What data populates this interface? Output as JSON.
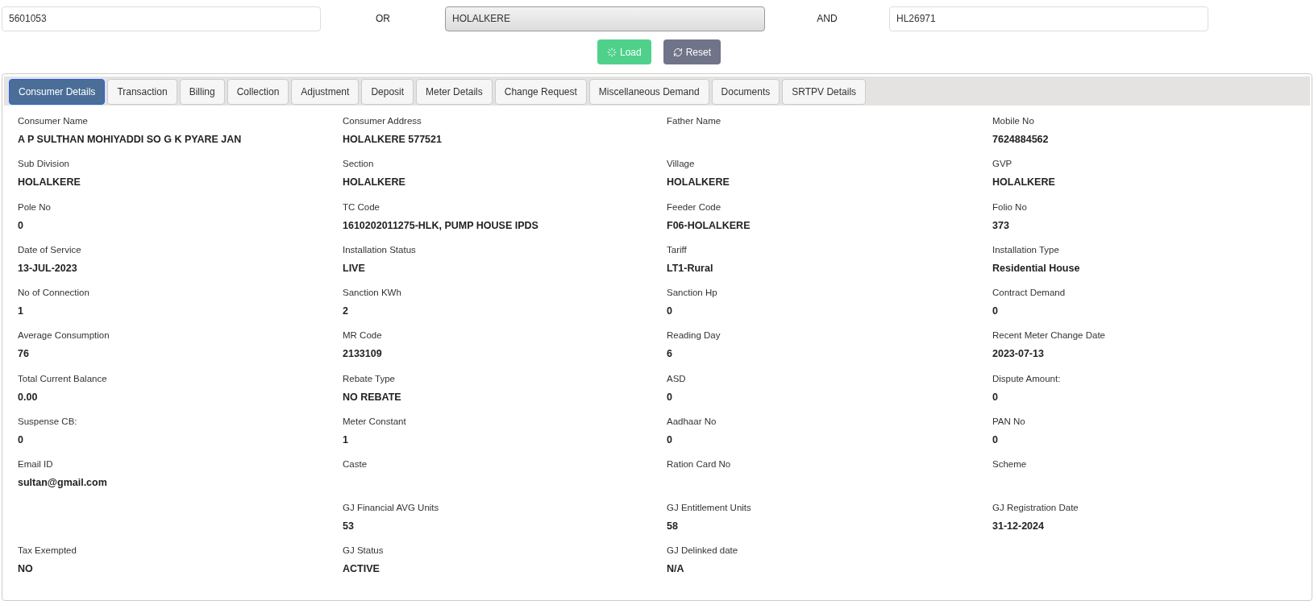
{
  "search": {
    "fields": [
      {
        "value": "5601053"
      },
      {
        "value": "HOLALKERE"
      },
      {
        "value": "HL26971"
      }
    ],
    "connectors": [
      "OR",
      "AND"
    ]
  },
  "buttons": [
    {
      "kind": "load",
      "label": "Load"
    },
    {
      "kind": "reset",
      "label": "Reset"
    }
  ],
  "tabs": [
    {
      "label": "Consumer Details",
      "selected": true
    },
    {
      "label": "Transaction",
      "selected": false
    },
    {
      "label": "Billing",
      "selected": false
    },
    {
      "label": "Collection",
      "selected": false
    },
    {
      "label": "Adjustment",
      "selected": false
    },
    {
      "label": "Deposit",
      "selected": false
    },
    {
      "label": "Meter Details",
      "selected": false
    },
    {
      "label": "Change Request",
      "selected": false
    },
    {
      "label": "Miscellaneous Demand",
      "selected": false
    },
    {
      "label": "Documents",
      "selected": false
    },
    {
      "label": "SRTPV Details",
      "selected": false
    }
  ],
  "details": [
    [
      {
        "kind": "field",
        "label": "Consumer Name",
        "value": "A P SULTHAN MOHIYADDI SO G K PYARE JAN"
      },
      {
        "kind": "field",
        "label": "Consumer Address",
        "value": "HOLALKERE 577521"
      },
      {
        "kind": "field",
        "label": "Father Name"
      },
      {
        "kind": "field",
        "label": "Mobile No",
        "value": "7624884562"
      }
    ],
    [
      {
        "kind": "field",
        "label": "Sub Division",
        "value": "HOLALKERE"
      },
      {
        "kind": "field",
        "label": "Section",
        "value": "HOLALKERE"
      },
      {
        "kind": "field",
        "label": "Village",
        "value": "HOLALKERE"
      },
      {
        "kind": "field",
        "label": "GVP",
        "value": "HOLALKERE"
      }
    ],
    [
      {
        "kind": "field",
        "label": "Pole No",
        "value": "0"
      },
      {
        "kind": "field",
        "label": "TC Code",
        "value": "1610202011275-HLK, PUMP HOUSE IPDS"
      },
      {
        "kind": "field",
        "label": "Feeder Code",
        "value": "F06-HOLALKERE"
      },
      {
        "kind": "field",
        "label": "Folio No",
        "value": "373"
      }
    ],
    [
      {
        "kind": "field",
        "label": "Date of Service",
        "value": "13-JUL-2023"
      },
      {
        "kind": "field",
        "label": "Installation Status",
        "value": "LIVE"
      },
      {
        "kind": "field",
        "label": "Tariff",
        "value": "LT1-Rural"
      },
      {
        "kind": "field",
        "label": "Installation Type",
        "value": "Residential House"
      }
    ],
    [
      {
        "kind": "field",
        "label": "No of Connection",
        "value": "1"
      },
      {
        "kind": "field",
        "label": "Sanction KWh",
        "value": "2"
      },
      {
        "kind": "field",
        "label": "Sanction Hp",
        "value": "0"
      },
      {
        "kind": "field",
        "label": "Contract Demand",
        "value": "0"
      }
    ],
    [
      {
        "kind": "field",
        "label": "Average Consumption",
        "value": "76"
      },
      {
        "kind": "field",
        "label": "MR Code",
        "value": "2133109"
      },
      {
        "kind": "field",
        "label": "Reading Day",
        "value": "6"
      },
      {
        "kind": "field",
        "label": "Recent Meter Change Date",
        "value": "2023-07-13"
      }
    ],
    [
      {
        "kind": "field",
        "label": "Total Current Balance",
        "value": "0.00"
      },
      {
        "kind": "field",
        "label": "Rebate Type",
        "value": "NO REBATE"
      },
      {
        "kind": "field",
        "label": "ASD",
        "value": "0"
      },
      {
        "kind": "field",
        "label": "Dispute Amount:",
        "value": "0"
      }
    ],
    [
      {
        "kind": "field",
        "label": "Suspense CB:",
        "value": "0"
      },
      {
        "kind": "field",
        "label": "Meter Constant",
        "value": "1"
      },
      {
        "kind": "field",
        "label": "Aadhaar No",
        "value": "0"
      },
      {
        "kind": "field",
        "label": "PAN No",
        "value": "0"
      }
    ],
    [
      {
        "kind": "field",
        "label": "Email ID",
        "value": "sultan@gmail.com"
      },
      {
        "kind": "field",
        "label": "Caste"
      },
      {
        "kind": "field",
        "label": "Ration Card No"
      },
      {
        "kind": "field",
        "label": "Scheme"
      }
    ],
    [
      {
        "kind": "blank"
      },
      {
        "kind": "field",
        "label": "GJ Financial AVG Units",
        "value": "53"
      },
      {
        "kind": "field",
        "label": "GJ Entitlement Units",
        "value": "58"
      },
      {
        "kind": "field",
        "label": "GJ Registration Date",
        "value": "31-12-2024"
      }
    ],
    [
      {
        "kind": "field",
        "label": "Tax Exempted",
        "value": "NO"
      },
      {
        "kind": "field",
        "label": "GJ Status",
        "value": "ACTIVE"
      },
      {
        "kind": "field",
        "label": "GJ Delinked date",
        "value": "N/A"
      },
      {
        "kind": "blank"
      }
    ]
  ]
}
